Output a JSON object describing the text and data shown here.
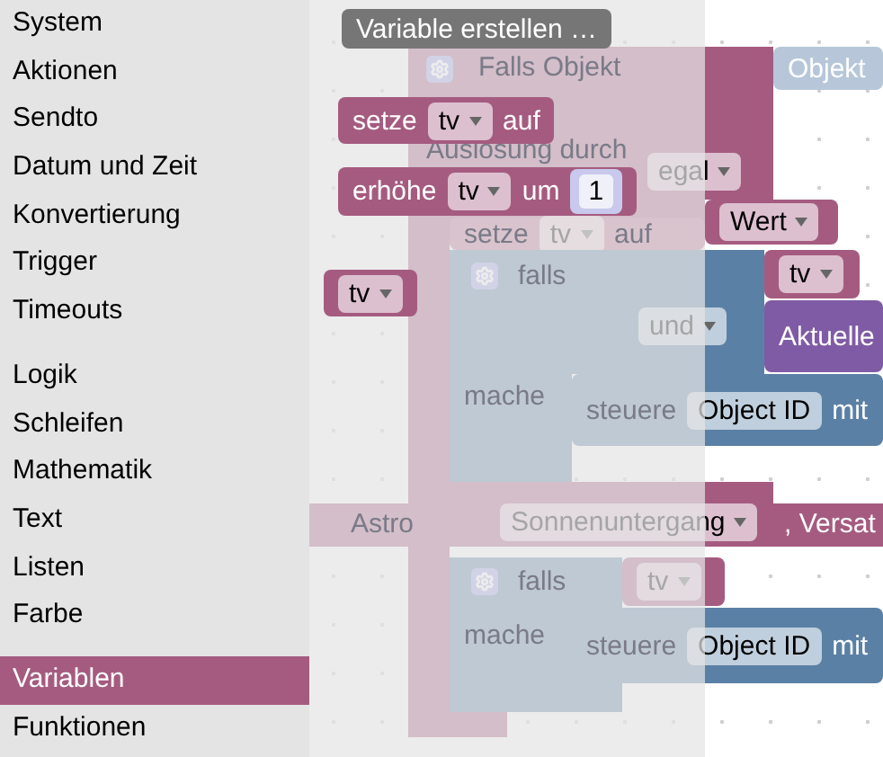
{
  "categories": [
    [
      {
        "label": "System",
        "selected": false
      },
      {
        "label": "Aktionen",
        "selected": false
      },
      {
        "label": "Sendto",
        "selected": false
      },
      {
        "label": "Datum und Zeit",
        "selected": false
      },
      {
        "label": "Konvertierung",
        "selected": false
      },
      {
        "label": "Trigger",
        "selected": false
      },
      {
        "label": "Timeouts",
        "selected": false
      }
    ],
    [
      {
        "label": "Logik",
        "selected": false
      },
      {
        "label": "Schleifen",
        "selected": false
      },
      {
        "label": "Mathematik",
        "selected": false
      },
      {
        "label": "Text",
        "selected": false
      },
      {
        "label": "Listen",
        "selected": false
      },
      {
        "label": "Farbe",
        "selected": false
      }
    ],
    [
      {
        "label": "Variablen",
        "selected": true
      },
      {
        "label": "Funktionen",
        "selected": false
      }
    ]
  ],
  "flyout": {
    "button": "Variable erstellen …",
    "blocks": [
      {
        "kind": "setter",
        "words": [
          "setze",
          "auf"
        ],
        "variable": "tv"
      },
      {
        "kind": "change",
        "words": [
          "erhöhe",
          "um"
        ],
        "variable": "tv",
        "amount": "1"
      },
      {
        "kind": "getter",
        "variable": "tv"
      }
    ]
  },
  "workspace": {
    "event": {
      "title": "Falls Objekt",
      "input": "Objekt",
      "trigger_label": "Auslösung durch",
      "trigger_value": "egal",
      "setter": {
        "words": [
          "setze",
          "auf"
        ],
        "variable": "tv"
      },
      "value": "Wert"
    },
    "conditions": [
      {
        "label": "falls",
        "operator": "und",
        "inputs": [
          {
            "kind": "variable",
            "text": "tv"
          },
          {
            "kind": "function",
            "text": "Aktuelle"
          }
        ],
        "do_label": "mache",
        "action": {
          "words": [
            "steuere",
            "mit"
          ],
          "object": "Object ID"
        }
      },
      {
        "label": "falls",
        "inputs": [
          {
            "kind": "variable",
            "text": "tv"
          }
        ],
        "do_label": "mache",
        "action": {
          "words": [
            "steuere",
            "mit"
          ],
          "object": "Object ID"
        }
      }
    ],
    "astro": {
      "label": "Astro",
      "value": "Sonnenuntergang",
      "suffix": ", Versat"
    }
  }
}
